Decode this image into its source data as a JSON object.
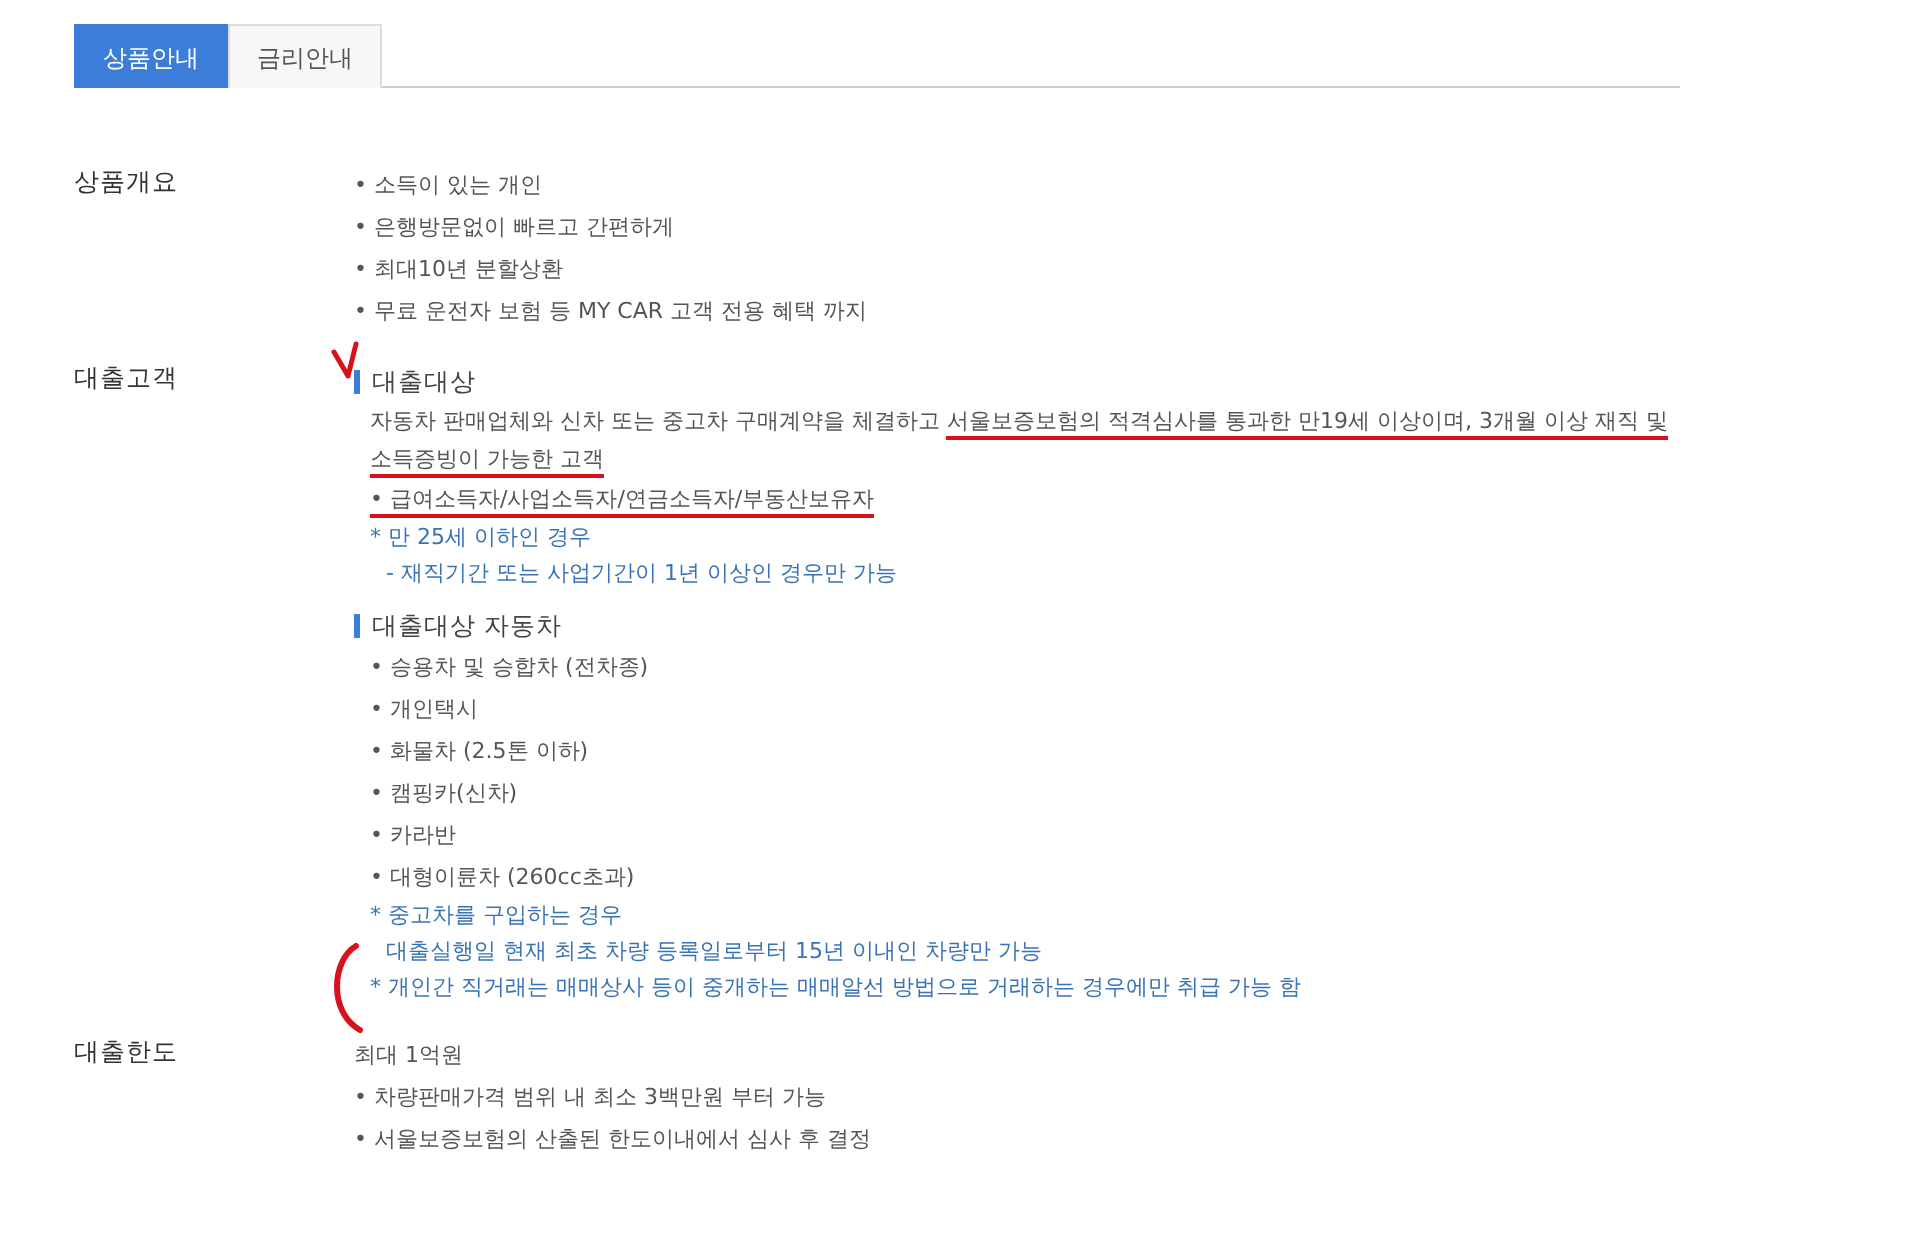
{
  "tabs": [
    {
      "label": "상품안내",
      "selected": true
    },
    {
      "label": "금리안내",
      "selected": false
    }
  ],
  "sections": [
    {
      "label": "상품개요",
      "groups": [
        {
          "items": [
            {
              "kind": "bullet",
              "text": "• 소득이 있는 개인"
            },
            {
              "kind": "bullet",
              "text": "• 은행방문없이 빠르고 간편하게"
            },
            {
              "kind": "bullet",
              "text": "• 최대10년 분할상환"
            },
            {
              "kind": "bullet",
              "text": "• 무료 운전자 보험 등 MY CAR 고객 전용 혜택 까지"
            }
          ]
        }
      ]
    },
    {
      "label": "대출고객",
      "groups": [
        {
          "heading": "대출대상",
          "items": [
            {
              "kind": "text",
              "parts": [
                {
                  "text": "자동차 판매업체와 신차 또는 중고차 구매계약을 체결하고 ",
                  "underlined": false
                },
                {
                  "text": "서울보증보험의 적격심사를 통과한 만19세 이상이며, 3개월 이상 재직 및 소득증빙이 가능한 고객",
                  "underlined": true
                }
              ]
            },
            {
              "kind": "bullet",
              "text": "• 급여소득자/사업소득자/연금소득자/부동산보유자",
              "underlined": true
            },
            {
              "kind": "note",
              "text": "* 만 25세 이하인 경우"
            },
            {
              "kind": "note-cont",
              "text": "- 재직기간 또는 사업기간이 1년 이상인 경우만 가능"
            }
          ]
        },
        {
          "heading": "대출대상 자동차",
          "items": [
            {
              "kind": "bullet",
              "text": "• 승용차 및 승합차 (전차종)"
            },
            {
              "kind": "bullet",
              "text": "• 개인택시"
            },
            {
              "kind": "bullet",
              "text": "• 화물차 (2.5톤 이하)"
            },
            {
              "kind": "bullet",
              "text": "• 캠핑카(신차)"
            },
            {
              "kind": "bullet",
              "text": "• 카라반"
            },
            {
              "kind": "bullet",
              "text": "• 대형이륜차 (260cc초과)"
            },
            {
              "kind": "note",
              "text": "* 중고차를 구입하는 경우"
            },
            {
              "kind": "note-cont",
              "text": "대출실행일 현재 최초 차량 등록일로부터 15년 이내인 차량만 가능"
            },
            {
              "kind": "note",
              "text": "* 개인간 직거래는 매매상사 등이 중개하는 매매알선 방법으로 거래하는 경우에만 취급 가능 함"
            }
          ]
        }
      ]
    },
    {
      "label": "대출한도",
      "groups": [
        {
          "items": [
            {
              "kind": "plain",
              "text": "최대 1억원"
            },
            {
              "kind": "bullet",
              "text": "• 차량판매가격 범위 내 최소 3백만원 부터 가능"
            },
            {
              "kind": "bullet",
              "text": "• 서울보증보험의 산출된 한도이내에서 심사 후 결정"
            }
          ]
        }
      ]
    }
  ]
}
